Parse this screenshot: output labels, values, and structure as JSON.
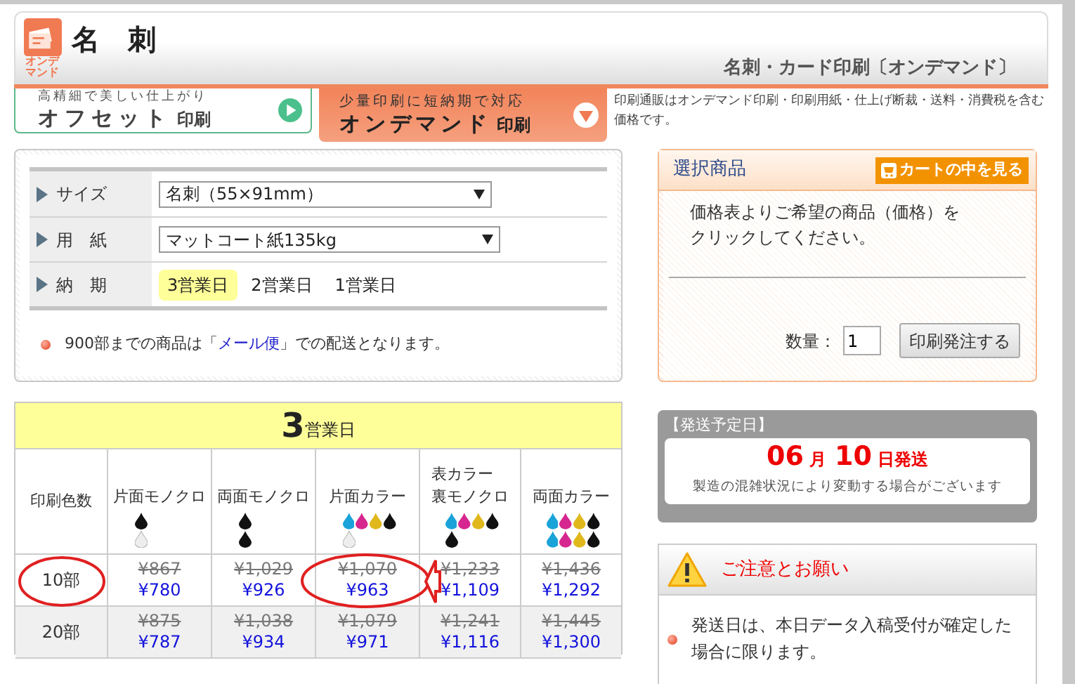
{
  "header": {
    "logo_text": [
      "オンデ",
      "マンド"
    ],
    "title": "名　刺",
    "subtitle": "名刺・カード印刷〔オンデマンド〕"
  },
  "tabs": [
    {
      "caption": "高精細で美しい仕上がり",
      "label": "オフセット",
      "suffix": "印刷",
      "selected": false
    },
    {
      "caption": "少量印刷に短納期で対応",
      "label": "オンデマンド",
      "suffix": "印刷",
      "selected": true
    }
  ],
  "tabs_note": "印刷通販はオンデマンド印刷・印刷用紙・仕上げ断裁・送料・消費税を含む価格です。",
  "options": [
    {
      "kind": "select",
      "label": "サイズ",
      "value": "名刺（55×91mm）"
    },
    {
      "kind": "select",
      "label": "用　紙",
      "value": "マットコート紙135kg"
    },
    {
      "kind": "choices",
      "label": "納　期",
      "choices": [
        {
          "label": "3営業日",
          "selected": true
        },
        {
          "label": "2営業日",
          "selected": false
        },
        {
          "label": "1営業日",
          "selected": false
        }
      ]
    }
  ],
  "options_note": {
    "before": "900部までの商品は「",
    "link": "メール便",
    "after": "」での配送となります。"
  },
  "selection": {
    "title": "選択商品",
    "cart_button": "カートの中を見る",
    "message": "価格表よりご希望の商品（価格）をクリックしてください。",
    "quantity_label": "数量：",
    "quantity": "1",
    "order_button": "印刷発注する"
  },
  "price_table": {
    "number": "3",
    "unit": "営業日",
    "corner": "印刷色数",
    "columns": [
      {
        "label": "片面モノクロ",
        "drops": [
          [
            {
              "color": "#111111"
            }
          ],
          [
            {
              "color": "#eeeeee"
            }
          ]
        ]
      },
      {
        "label": "両面モノクロ",
        "drops": [
          [
            {
              "color": "#111111"
            }
          ],
          [
            {
              "color": "#111111"
            }
          ]
        ]
      },
      {
        "label": "片面カラー",
        "drops": [
          [
            {
              "color": "#1aa3d9"
            },
            {
              "color": "#d6268f"
            },
            {
              "color": "#e0b81c"
            },
            {
              "color": "#111111"
            }
          ],
          [
            {
              "color": "#eeeeee"
            }
          ]
        ]
      },
      {
        "label": [
          "表カラー",
          "裏モノクロ"
        ],
        "drops": [
          [
            {
              "color": "#1aa3d9"
            },
            {
              "color": "#d6268f"
            },
            {
              "color": "#e0b81c"
            },
            {
              "color": "#111111"
            }
          ],
          [
            {
              "color": "#111111"
            }
          ]
        ]
      },
      {
        "label": "両面カラー",
        "drops": [
          [
            {
              "color": "#1aa3d9"
            },
            {
              "color": "#d6268f"
            },
            {
              "color": "#e0b81c"
            },
            {
              "color": "#111111"
            }
          ],
          [
            {
              "color": "#1aa3d9"
            },
            {
              "color": "#d6268f"
            },
            {
              "color": "#e0b81c"
            },
            {
              "color": "#111111"
            }
          ]
        ]
      }
    ],
    "rows": [
      {
        "quantity": "10部",
        "prices": [
          {
            "list": "¥867",
            "sale": "¥780"
          },
          {
            "list": "¥1,029",
            "sale": "¥926"
          },
          {
            "list": "¥1,070",
            "sale": "¥963"
          },
          {
            "list": "¥1,233",
            "sale": "¥1,109"
          },
          {
            "list": "¥1,436",
            "sale": "¥1,292"
          }
        ]
      },
      {
        "quantity": "20部",
        "prices": [
          {
            "list": "¥875",
            "sale": "¥787"
          },
          {
            "list": "¥1,038",
            "sale": "¥934"
          },
          {
            "list": "¥1,079",
            "sale": "¥971"
          },
          {
            "list": "¥1,241",
            "sale": "¥1,116"
          },
          {
            "list": "¥1,445",
            "sale": "¥1,300"
          }
        ]
      }
    ]
  },
  "shipping": {
    "title": "【発送予定日】",
    "month": "06",
    "month_unit": "月",
    "day": "10",
    "day_unit": "日発送",
    "note": "製造の混雑状況により変動する場合がございます"
  },
  "notice": {
    "title": "ご注意とお願い",
    "items": [
      "発送日は、本日データ入稿受付が確定した場合に限ります。"
    ]
  }
}
